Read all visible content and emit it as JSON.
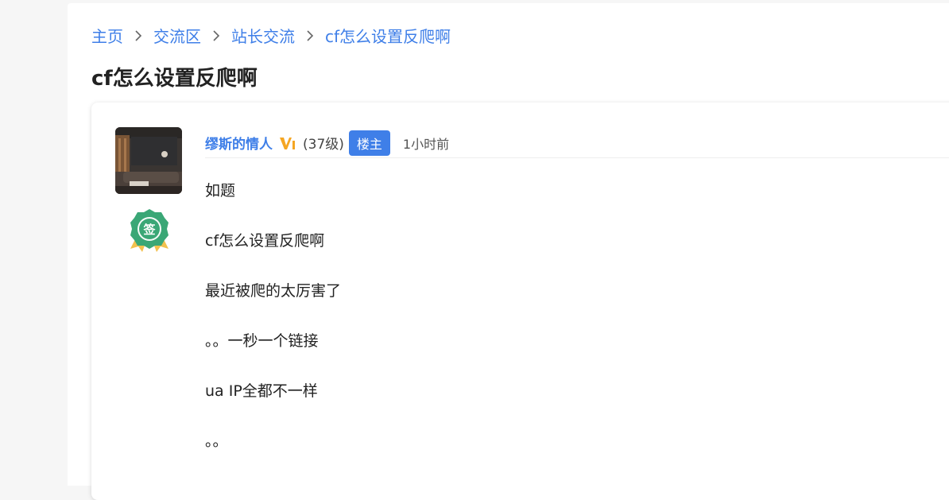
{
  "breadcrumb": {
    "items": [
      "主页",
      "交流区",
      "站长交流",
      "cf怎么设置反爬啊"
    ]
  },
  "page": {
    "title": "cf怎么设置反爬啊"
  },
  "post": {
    "author": "缪斯的情人",
    "vip_icon": "vip-v1-icon",
    "level": "(37级)",
    "op_tag": "楼主",
    "time": "1小时前",
    "medal_icon": "sign-in-medal-icon",
    "medal_char": "签",
    "content": [
      "如题",
      "cf怎么设置反爬啊",
      "最近被爬的太厉害了",
      "。。一秒一个链接",
      "ua IP全都不一样",
      "。。"
    ]
  },
  "colors": {
    "link": "#3f7fe8",
    "tag_bg": "#3f7fe8",
    "vip_orange": "#f5a623",
    "medal_green": "#3aa776"
  }
}
